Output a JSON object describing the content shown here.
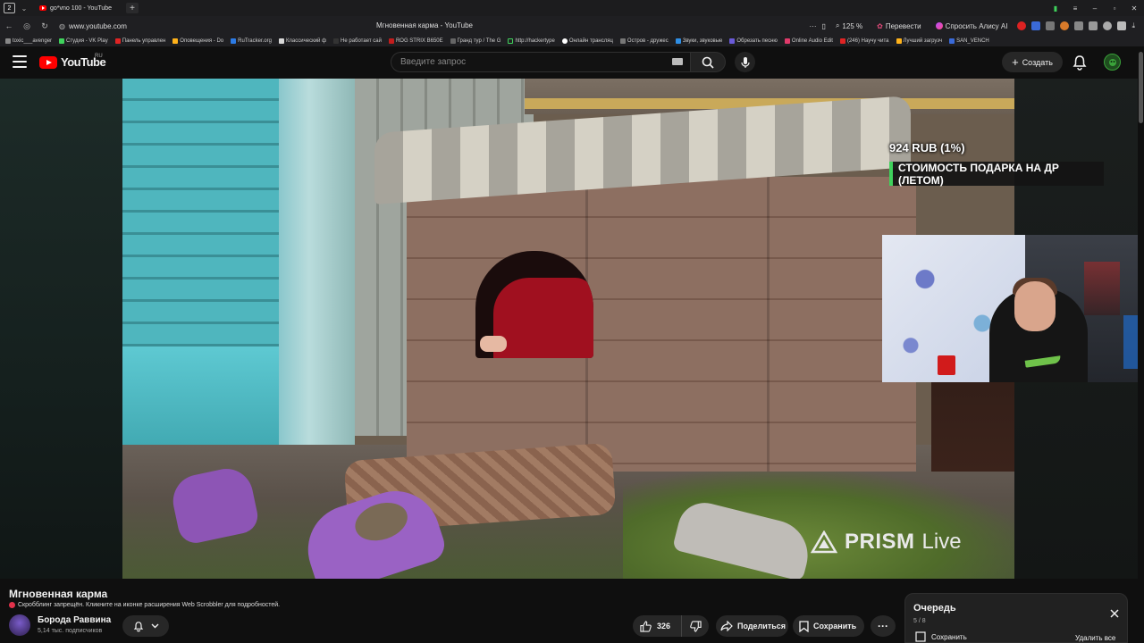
{
  "browser": {
    "tab_count": "2",
    "active_tab_title": "go*vno 100 - YouTube",
    "url": "www.youtube.com",
    "page_title": "Мгновенная карма - YouTube",
    "zoom": "125 %",
    "translate_label": "Перевести",
    "alisa_label": "Спросить Алису AI",
    "bookmarks": [
      "toxic___avenger",
      "Студия - VK Play",
      "Панель управлен",
      "Оповещения - Do",
      "RuTracker.org",
      "Классический ф",
      "Не работает сай",
      "ROG STRIX B650E",
      "Гранд тур / The G",
      "http://hackertype",
      "Онлайн трансляц",
      "Остров - дружес",
      "Звуки, звуковые",
      "Обрезать песню",
      "Online Audio Edit",
      "(246) Научу чита",
      "Лучший загрузч",
      "SAN_VENCH"
    ]
  },
  "youtube": {
    "logo_text": "YouTube",
    "region": "RU",
    "search_placeholder": "Введите запрос",
    "create_label": "Создать"
  },
  "overlay": {
    "donation_amount": "924 RUB (1%)",
    "donation_goal": "СТОИМОСТЬ ПОДАРКА НА ДР (ЛЕТОМ)",
    "watermark_bold": "PRISM",
    "watermark_light": "Live"
  },
  "video": {
    "title": "Мгновенная карма",
    "scrobbler_notice": "Скробблинг запрещён. Кликните на иконке расширения Web Scrobbler для подробностей.",
    "channel_name": "Борода Раввина",
    "subscribers": "5,14 тыс. подписчиков",
    "likes": "326",
    "share_label": "Поделиться",
    "save_label": "Сохранить"
  },
  "queue": {
    "title": "Очередь",
    "count": "5 / 8",
    "save_label": "Сохранить",
    "delete_all_label": "Удалить все"
  },
  "colors": {
    "background": "#0f0f0f",
    "yt_red": "#ff0000",
    "button_bg": "#272727",
    "donation_accent": "#3fd25c"
  }
}
